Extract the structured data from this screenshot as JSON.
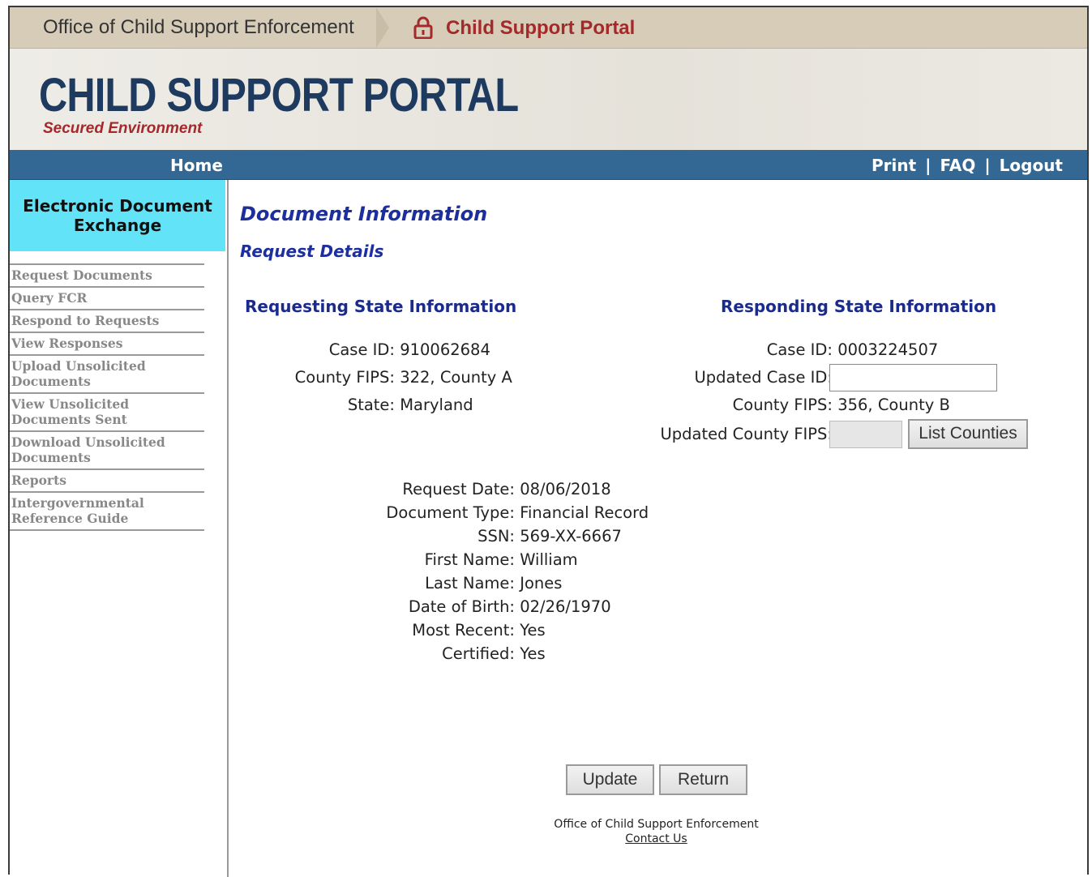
{
  "topbar": {
    "org": "Office of Child Support Enforcement",
    "portal": "Child Support Portal"
  },
  "banner": {
    "title": "CHILD SUPPORT PORTAL",
    "subtitle": "Secured Environment"
  },
  "nav": {
    "home": "Home",
    "print": "Print",
    "faq": "FAQ",
    "logout": "Logout",
    "separator": "|"
  },
  "sidebar": {
    "heading_line1": "Electronic Document",
    "heading_line2": "Exchange",
    "items": [
      {
        "label": "Request Documents"
      },
      {
        "label": "Query FCR"
      },
      {
        "label": "Respond to Requests"
      },
      {
        "label": "View Responses"
      },
      {
        "label": "Upload Unsolicited Documents"
      },
      {
        "label": "View Unsolicited Documents Sent"
      },
      {
        "label": "Download Unsolicited Documents"
      },
      {
        "label": "Reports"
      },
      {
        "label": "Intergovernmental Reference Guide"
      }
    ]
  },
  "main": {
    "title": "Document Information",
    "subtitle": "Request Details",
    "requesting": {
      "heading": "Requesting State Information",
      "case_id_label": "Case ID:",
      "case_id": "910062684",
      "county_label": "County FIPS:",
      "county": "322, County A",
      "state_label": "State:",
      "state": "Maryland"
    },
    "responding": {
      "heading": "Responding State Information",
      "case_id_label": "Case ID:",
      "case_id": "0003224507",
      "updated_case_label": "Updated Case ID:",
      "updated_case_value": "",
      "county_label": "County FIPS:",
      "county": "356, County B",
      "updated_county_label": "Updated County FIPS:",
      "updated_county_value": "",
      "list_counties": "List Counties"
    },
    "details": [
      {
        "label": "Request Date:",
        "value": "08/06/2018"
      },
      {
        "label": "Document Type:",
        "value": "Financial Record"
      },
      {
        "label": "SSN:",
        "value": "569-XX-6667"
      },
      {
        "label": "First Name:",
        "value": "William"
      },
      {
        "label": "Last Name:",
        "value": "Jones"
      },
      {
        "label": "Date of Birth:",
        "value": "02/26/1970"
      },
      {
        "label": "Most Recent:",
        "value": "Yes"
      },
      {
        "label": "Certified:",
        "value": "Yes"
      }
    ],
    "update_button": "Update",
    "return_button": "Return",
    "footer_org": "Office of Child Support Enforcement",
    "footer_contact": "Contact Us"
  },
  "colors": {
    "accent_red": "#a5282b",
    "nav_blue": "#336894",
    "sidebar_cyan": "#62e3f8",
    "heading_blue": "#1d2e9e"
  }
}
